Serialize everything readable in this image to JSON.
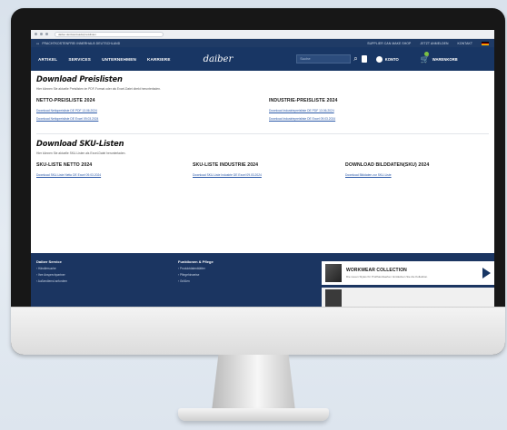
{
  "browser": {
    "url": "daiber.de/downloads/preislisten"
  },
  "topbar": {
    "location": "FRACHTKOSTENFREI INNERHALB DEUTSCHLAND",
    "links": [
      "SUPPLIER CAN MAKE SHOP",
      "JETZT ANMELDEN",
      "KONTAKT"
    ]
  },
  "nav": {
    "items": [
      "ARTIKEL",
      "SERVICES",
      "UNTERNEHMEN",
      "KARRIERE"
    ],
    "logo": "daiber",
    "search_placeholder": "Suche",
    "account_label": "KONTO",
    "cart_label": "WARENKORB"
  },
  "preislisten": {
    "title": "Download Preislisten",
    "note": "Hier können Sie aktuelle Preislisten im PDF-Format oder als Excel-Datei direkt herunterladen.",
    "netto": {
      "heading": "NETTO-PREISLISTE 2024",
      "links": [
        "Download Nettopreisliste DE PDF 13.06.2024",
        "Download Nettopreisliste DE Excel 09.03.2024"
      ]
    },
    "industrie": {
      "heading": "INDUSTRIE-PREISLISTE 2024",
      "links": [
        "Download Industriepreisliste DE PDF 13.06.2024",
        "Download Industriepreisliste DE Excel 09.03.2024"
      ]
    }
  },
  "sku": {
    "title": "Download SKU-Listen",
    "note": "Hier können Sie aktuelle SKU-Listen als Excel-Datei herunterladen.",
    "netto": {
      "heading": "SKU-LISTE NETTO 2024",
      "link": "Download SKU-Liste Netto DE Excel 09.03.2024"
    },
    "industrie": {
      "heading": "SKU-LISTE INDUSTRIE 2024",
      "link": "Download SKU-Liste Industrie DE Excel 09.03.2024"
    },
    "bilddaten": {
      "heading": "DOWNLOAD BILDDATEN(SKU) 2024",
      "link": "Download Bilddaten zur SKU-Liste"
    }
  },
  "footer": {
    "service": {
      "heading": "Daiber Service",
      "items": [
        "Händlersuche",
        "Ihre Ansprechpartner",
        "Außendienst anfordern"
      ]
    },
    "pflege": {
      "heading": "Funktionen & Pflege",
      "items": [
        "Produktdatenblätter",
        "Pflegehinweise",
        "Größen"
      ]
    },
    "promo": {
      "title": "WORKWEAR COLLECTION",
      "subtitle": "Die neuen Styles für Profihandwerker. Entdecken Sie die Kollektion."
    }
  }
}
